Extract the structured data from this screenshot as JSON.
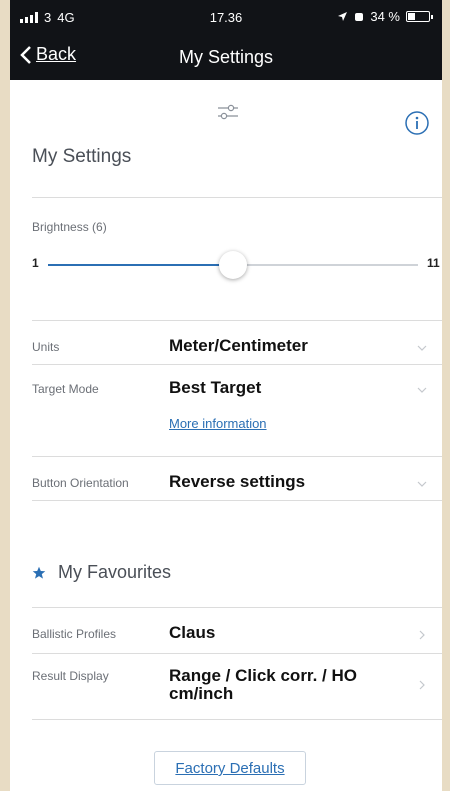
{
  "status_bar": {
    "carrier": "3",
    "network": "4G",
    "time": "17.36",
    "battery": "34 %",
    "battery_level": 0.34
  },
  "nav": {
    "back_label": "Back",
    "title": "My Settings"
  },
  "settings": {
    "section_title": "My Settings",
    "brightness": {
      "label": "Brightness (6)",
      "min": "1",
      "max": "11",
      "value": 6
    },
    "units": {
      "label": "Units",
      "value": "Meter/Centimeter"
    },
    "target_mode": {
      "label": "Target Mode",
      "value": "Best Target",
      "link": "More information"
    },
    "button_orientation": {
      "label": "Button Orientation",
      "value": "Reverse settings"
    }
  },
  "favourites": {
    "title": "My Favourites",
    "ballistic_profiles": {
      "label": "Ballistic Profiles",
      "value": "Claus"
    },
    "result_display": {
      "label": "Result Display",
      "value_line1": "Range / Click corr. / HO",
      "value_line2": "cm/inch"
    }
  },
  "factory_defaults_label": "Factory Defaults",
  "colors": {
    "accent": "#2b6fb4",
    "header_bg": "#111317"
  },
  "icons": [
    "back-chevron-icon",
    "filter-sliders-icon",
    "info-icon",
    "star-icon",
    "chevron-down-icon",
    "chevron-right-icon",
    "location-arrow-icon",
    "alarm-icon",
    "battery-icon",
    "signal-icon"
  ]
}
